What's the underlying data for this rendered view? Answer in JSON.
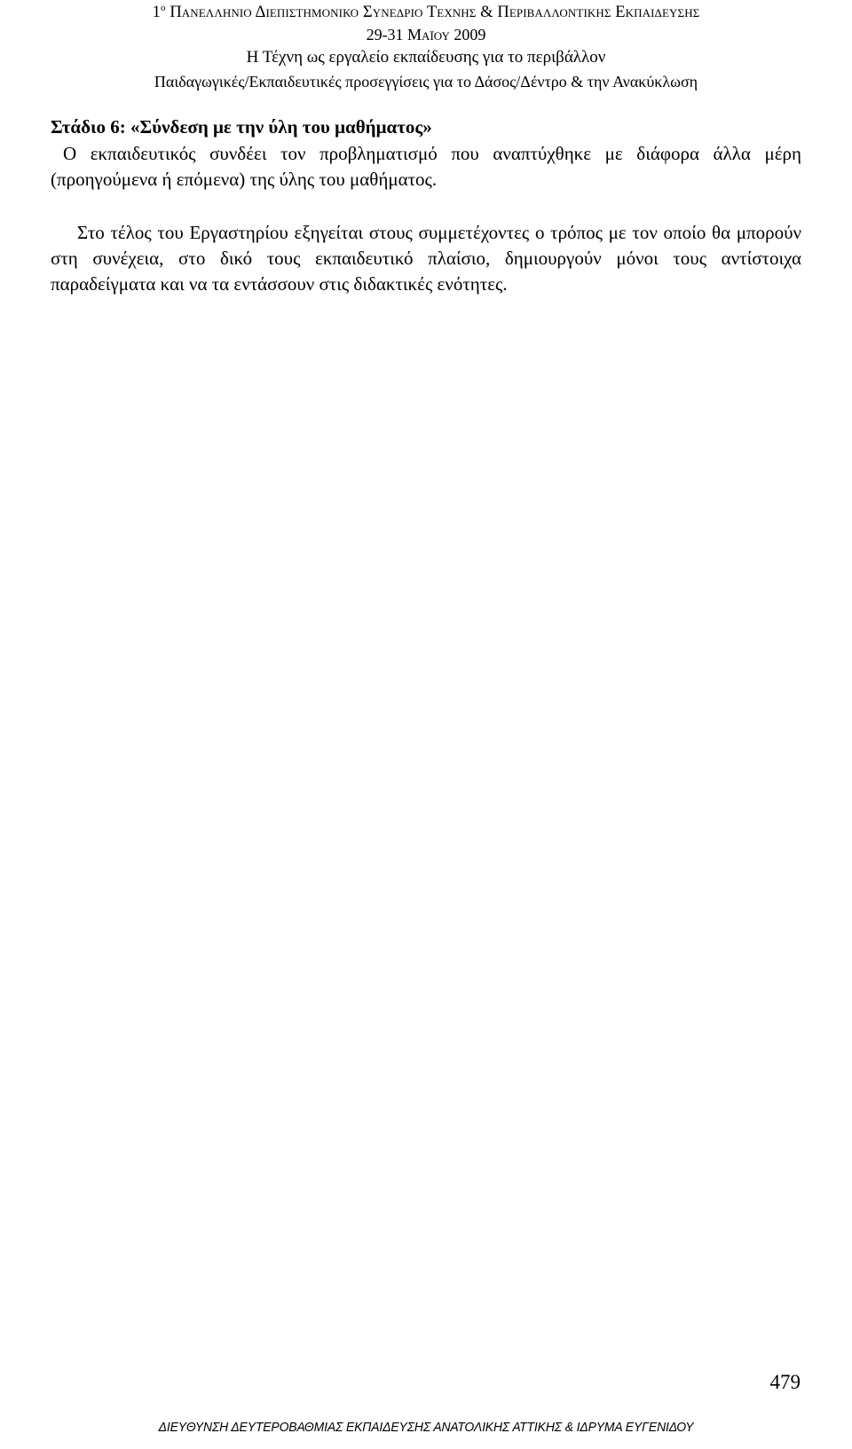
{
  "header": {
    "line1_prefix": "1",
    "line1_superscript": "ο",
    "line1_rest": " Πανελλήνιο Διεπιστημονικό Συνέδριο Τέχνης & Περιβαλλοντικής Εκπαίδευσης",
    "line2": "29-31 Μαΐου 2009",
    "line3": "Η Τέχνη ως εργαλείο εκπαίδευσης για το περιβάλλον",
    "line4": "Παιδαγωγικές/Εκπαιδευτικές προσεγγίσεις για το Δάσος/Δέντρο & την Ανακύκλωση"
  },
  "body": {
    "stage_heading": "Στάδιο 6: «Σύνδεση με την ύλη του μαθήματος»",
    "stage_paragraph": "Ο εκπαιδευτικός συνδέει τον προβληματισμό που αναπτύχθηκε με διάφορα άλλα μέρη (προηγούμενα ή επόμενα) της ύλης του μαθήματος.",
    "closing_paragraph": "Στο τέλος του Εργαστηρίου εξηγείται στους συμμετέχοντες ο τρόπος με τον οποίο θα μπορούν στη συνέχεια, στο δικό τους εκπαιδευτικό πλαίσιο, δημιουργούν μόνοι τους αντίστοιχα παραδείγματα και να τα εντάσσουν στις διδακτικές ενότητες."
  },
  "page_number": "479",
  "footer": {
    "text": "ΔΙΕΥΘΥΝΣΗ ΔΕΥΤΕΡΟΒΑΘΜΙΑΣ ΕΚΠΑΙΔΕΥΣΗΣ ΑΝΑΤΟΛΙΚΗΣ ΑΤΤΙΚΗΣ & ΙΔΡΥΜΑ ΕΥΓΕΝΙΔΟΥ"
  },
  "colors": {
    "text": "#000000",
    "background": "#ffffff"
  }
}
